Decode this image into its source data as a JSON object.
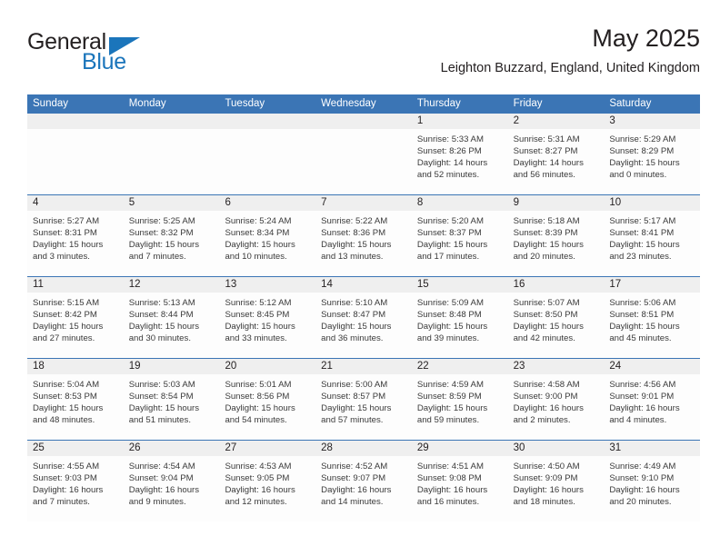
{
  "brand": {
    "name_part1": "General",
    "name_part2": "Blue",
    "logo_icon": "triangle-icon",
    "accent_color": "#1b75bb"
  },
  "header": {
    "title": "May 2025",
    "location": "Leighton Buzzard, England, United Kingdom"
  },
  "calendar": {
    "header_bg": "#3b75b5",
    "daynum_bg": "#efefef",
    "weekdays": [
      "Sunday",
      "Monday",
      "Tuesday",
      "Wednesday",
      "Thursday",
      "Friday",
      "Saturday"
    ],
    "weeks": [
      [
        {
          "day": "",
          "sunrise": "",
          "sunset": "",
          "daylight1": "",
          "daylight2": ""
        },
        {
          "day": "",
          "sunrise": "",
          "sunset": "",
          "daylight1": "",
          "daylight2": ""
        },
        {
          "day": "",
          "sunrise": "",
          "sunset": "",
          "daylight1": "",
          "daylight2": ""
        },
        {
          "day": "",
          "sunrise": "",
          "sunset": "",
          "daylight1": "",
          "daylight2": ""
        },
        {
          "day": "1",
          "sunrise": "Sunrise: 5:33 AM",
          "sunset": "Sunset: 8:26 PM",
          "daylight1": "Daylight: 14 hours",
          "daylight2": "and 52 minutes."
        },
        {
          "day": "2",
          "sunrise": "Sunrise: 5:31 AM",
          "sunset": "Sunset: 8:27 PM",
          "daylight1": "Daylight: 14 hours",
          "daylight2": "and 56 minutes."
        },
        {
          "day": "3",
          "sunrise": "Sunrise: 5:29 AM",
          "sunset": "Sunset: 8:29 PM",
          "daylight1": "Daylight: 15 hours",
          "daylight2": "and 0 minutes."
        }
      ],
      [
        {
          "day": "4",
          "sunrise": "Sunrise: 5:27 AM",
          "sunset": "Sunset: 8:31 PM",
          "daylight1": "Daylight: 15 hours",
          "daylight2": "and 3 minutes."
        },
        {
          "day": "5",
          "sunrise": "Sunrise: 5:25 AM",
          "sunset": "Sunset: 8:32 PM",
          "daylight1": "Daylight: 15 hours",
          "daylight2": "and 7 minutes."
        },
        {
          "day": "6",
          "sunrise": "Sunrise: 5:24 AM",
          "sunset": "Sunset: 8:34 PM",
          "daylight1": "Daylight: 15 hours",
          "daylight2": "and 10 minutes."
        },
        {
          "day": "7",
          "sunrise": "Sunrise: 5:22 AM",
          "sunset": "Sunset: 8:36 PM",
          "daylight1": "Daylight: 15 hours",
          "daylight2": "and 13 minutes."
        },
        {
          "day": "8",
          "sunrise": "Sunrise: 5:20 AM",
          "sunset": "Sunset: 8:37 PM",
          "daylight1": "Daylight: 15 hours",
          "daylight2": "and 17 minutes."
        },
        {
          "day": "9",
          "sunrise": "Sunrise: 5:18 AM",
          "sunset": "Sunset: 8:39 PM",
          "daylight1": "Daylight: 15 hours",
          "daylight2": "and 20 minutes."
        },
        {
          "day": "10",
          "sunrise": "Sunrise: 5:17 AM",
          "sunset": "Sunset: 8:41 PM",
          "daylight1": "Daylight: 15 hours",
          "daylight2": "and 23 minutes."
        }
      ],
      [
        {
          "day": "11",
          "sunrise": "Sunrise: 5:15 AM",
          "sunset": "Sunset: 8:42 PM",
          "daylight1": "Daylight: 15 hours",
          "daylight2": "and 27 minutes."
        },
        {
          "day": "12",
          "sunrise": "Sunrise: 5:13 AM",
          "sunset": "Sunset: 8:44 PM",
          "daylight1": "Daylight: 15 hours",
          "daylight2": "and 30 minutes."
        },
        {
          "day": "13",
          "sunrise": "Sunrise: 5:12 AM",
          "sunset": "Sunset: 8:45 PM",
          "daylight1": "Daylight: 15 hours",
          "daylight2": "and 33 minutes."
        },
        {
          "day": "14",
          "sunrise": "Sunrise: 5:10 AM",
          "sunset": "Sunset: 8:47 PM",
          "daylight1": "Daylight: 15 hours",
          "daylight2": "and 36 minutes."
        },
        {
          "day": "15",
          "sunrise": "Sunrise: 5:09 AM",
          "sunset": "Sunset: 8:48 PM",
          "daylight1": "Daylight: 15 hours",
          "daylight2": "and 39 minutes."
        },
        {
          "day": "16",
          "sunrise": "Sunrise: 5:07 AM",
          "sunset": "Sunset: 8:50 PM",
          "daylight1": "Daylight: 15 hours",
          "daylight2": "and 42 minutes."
        },
        {
          "day": "17",
          "sunrise": "Sunrise: 5:06 AM",
          "sunset": "Sunset: 8:51 PM",
          "daylight1": "Daylight: 15 hours",
          "daylight2": "and 45 minutes."
        }
      ],
      [
        {
          "day": "18",
          "sunrise": "Sunrise: 5:04 AM",
          "sunset": "Sunset: 8:53 PM",
          "daylight1": "Daylight: 15 hours",
          "daylight2": "and 48 minutes."
        },
        {
          "day": "19",
          "sunrise": "Sunrise: 5:03 AM",
          "sunset": "Sunset: 8:54 PM",
          "daylight1": "Daylight: 15 hours",
          "daylight2": "and 51 minutes."
        },
        {
          "day": "20",
          "sunrise": "Sunrise: 5:01 AM",
          "sunset": "Sunset: 8:56 PM",
          "daylight1": "Daylight: 15 hours",
          "daylight2": "and 54 minutes."
        },
        {
          "day": "21",
          "sunrise": "Sunrise: 5:00 AM",
          "sunset": "Sunset: 8:57 PM",
          "daylight1": "Daylight: 15 hours",
          "daylight2": "and 57 minutes."
        },
        {
          "day": "22",
          "sunrise": "Sunrise: 4:59 AM",
          "sunset": "Sunset: 8:59 PM",
          "daylight1": "Daylight: 15 hours",
          "daylight2": "and 59 minutes."
        },
        {
          "day": "23",
          "sunrise": "Sunrise: 4:58 AM",
          "sunset": "Sunset: 9:00 PM",
          "daylight1": "Daylight: 16 hours",
          "daylight2": "and 2 minutes."
        },
        {
          "day": "24",
          "sunrise": "Sunrise: 4:56 AM",
          "sunset": "Sunset: 9:01 PM",
          "daylight1": "Daylight: 16 hours",
          "daylight2": "and 4 minutes."
        }
      ],
      [
        {
          "day": "25",
          "sunrise": "Sunrise: 4:55 AM",
          "sunset": "Sunset: 9:03 PM",
          "daylight1": "Daylight: 16 hours",
          "daylight2": "and 7 minutes."
        },
        {
          "day": "26",
          "sunrise": "Sunrise: 4:54 AM",
          "sunset": "Sunset: 9:04 PM",
          "daylight1": "Daylight: 16 hours",
          "daylight2": "and 9 minutes."
        },
        {
          "day": "27",
          "sunrise": "Sunrise: 4:53 AM",
          "sunset": "Sunset: 9:05 PM",
          "daylight1": "Daylight: 16 hours",
          "daylight2": "and 12 minutes."
        },
        {
          "day": "28",
          "sunrise": "Sunrise: 4:52 AM",
          "sunset": "Sunset: 9:07 PM",
          "daylight1": "Daylight: 16 hours",
          "daylight2": "and 14 minutes."
        },
        {
          "day": "29",
          "sunrise": "Sunrise: 4:51 AM",
          "sunset": "Sunset: 9:08 PM",
          "daylight1": "Daylight: 16 hours",
          "daylight2": "and 16 minutes."
        },
        {
          "day": "30",
          "sunrise": "Sunrise: 4:50 AM",
          "sunset": "Sunset: 9:09 PM",
          "daylight1": "Daylight: 16 hours",
          "daylight2": "and 18 minutes."
        },
        {
          "day": "31",
          "sunrise": "Sunrise: 4:49 AM",
          "sunset": "Sunset: 9:10 PM",
          "daylight1": "Daylight: 16 hours",
          "daylight2": "and 20 minutes."
        }
      ]
    ]
  }
}
